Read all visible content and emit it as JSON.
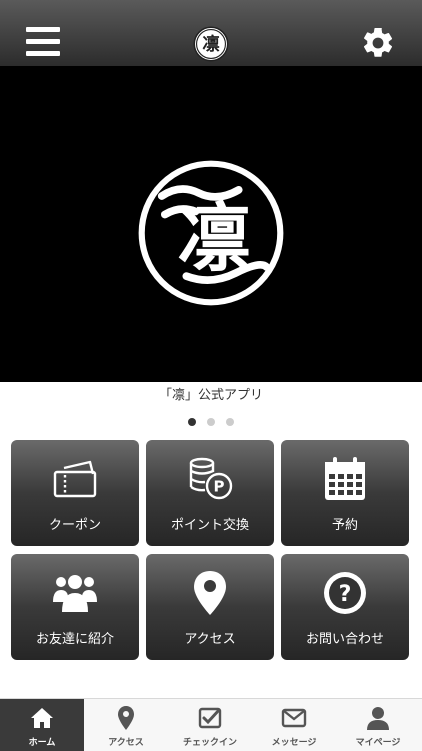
{
  "header": {
    "menu_icon": "hamburger-menu-icon",
    "logo_glyph": "凛",
    "settings_icon": "gear-icon"
  },
  "hero": {
    "logo_glyph": "凛"
  },
  "carousel": {
    "caption": "「凛」公式アプリ",
    "total_pages": 3,
    "active_page": 1
  },
  "menu": {
    "tiles": [
      {
        "label": "クーポン",
        "icon": "ticket-icon"
      },
      {
        "label": "ポイント交換",
        "icon": "coins-icon"
      },
      {
        "label": "予約",
        "icon": "calendar-icon"
      },
      {
        "label": "お友達に紹介",
        "icon": "people-icon"
      },
      {
        "label": "アクセス",
        "icon": "map-pin-icon"
      },
      {
        "label": "お問い合わせ",
        "icon": "question-icon"
      }
    ]
  },
  "tabbar": {
    "tabs": [
      {
        "label": "ホーム",
        "icon": "home-icon",
        "active": true
      },
      {
        "label": "アクセス",
        "icon": "map-pin-icon",
        "active": false
      },
      {
        "label": "チェックイン",
        "icon": "checkin-icon",
        "active": false
      },
      {
        "label": "メッセージ",
        "icon": "envelope-icon",
        "active": false
      },
      {
        "label": "マイページ",
        "icon": "person-icon",
        "active": false
      }
    ]
  },
  "colors": {
    "header_bg": "#3a3a3a",
    "hero_bg": "#000000",
    "tile_bg": "#333333",
    "active_tab_bg": "#3a3a3a"
  }
}
